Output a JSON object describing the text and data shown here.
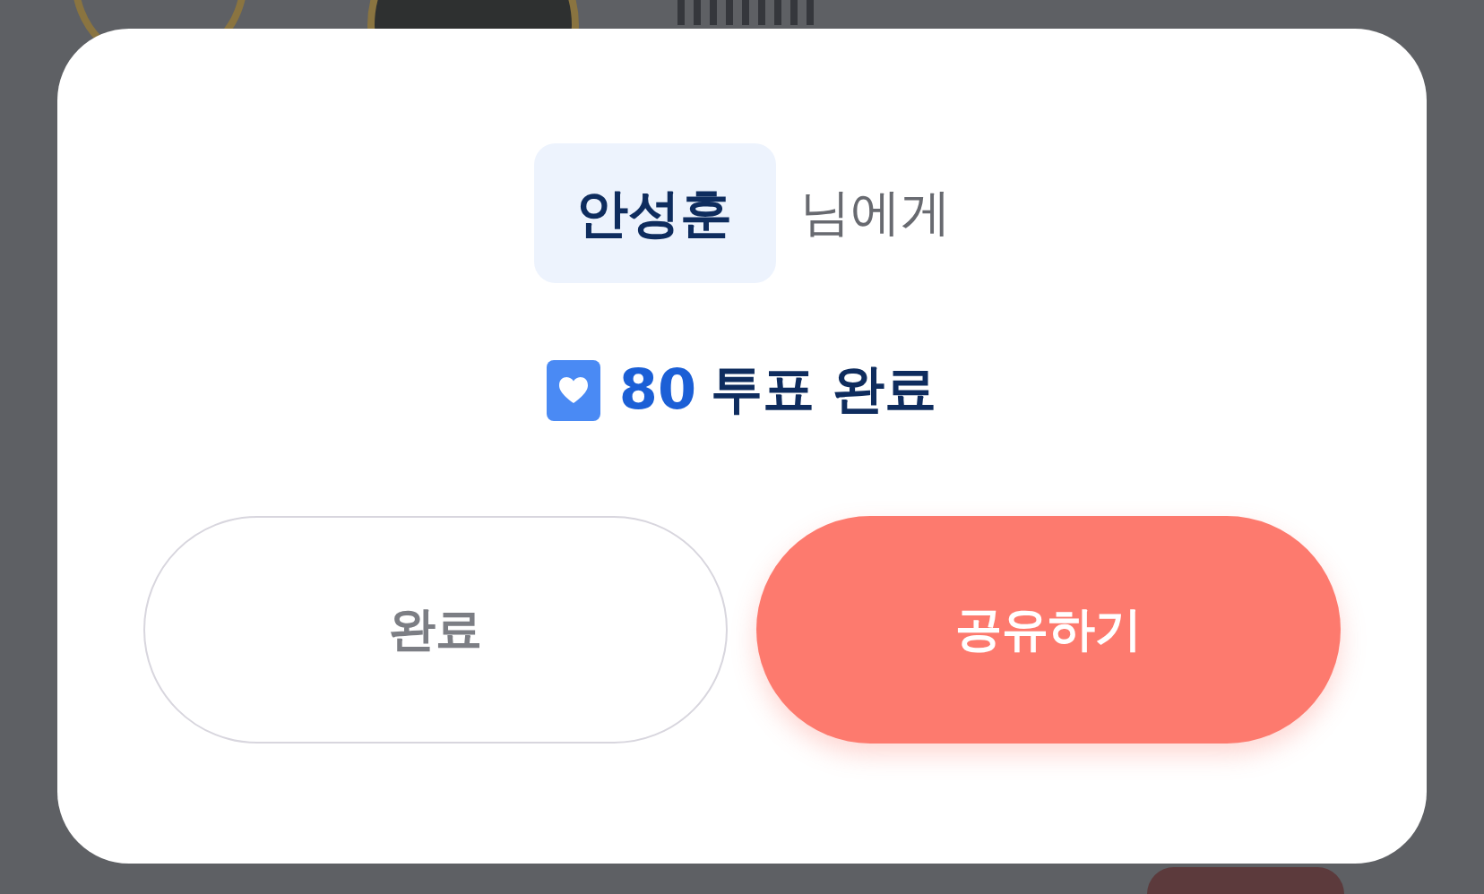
{
  "dialog": {
    "recipient": "안성훈",
    "suffix": "님에게",
    "vote_count": "80",
    "vote_label": "투표 완료",
    "buttons": [
      {
        "label": "완료",
        "kind": "secondary"
      },
      {
        "label": "공유하기",
        "kind": "primary"
      }
    ]
  }
}
